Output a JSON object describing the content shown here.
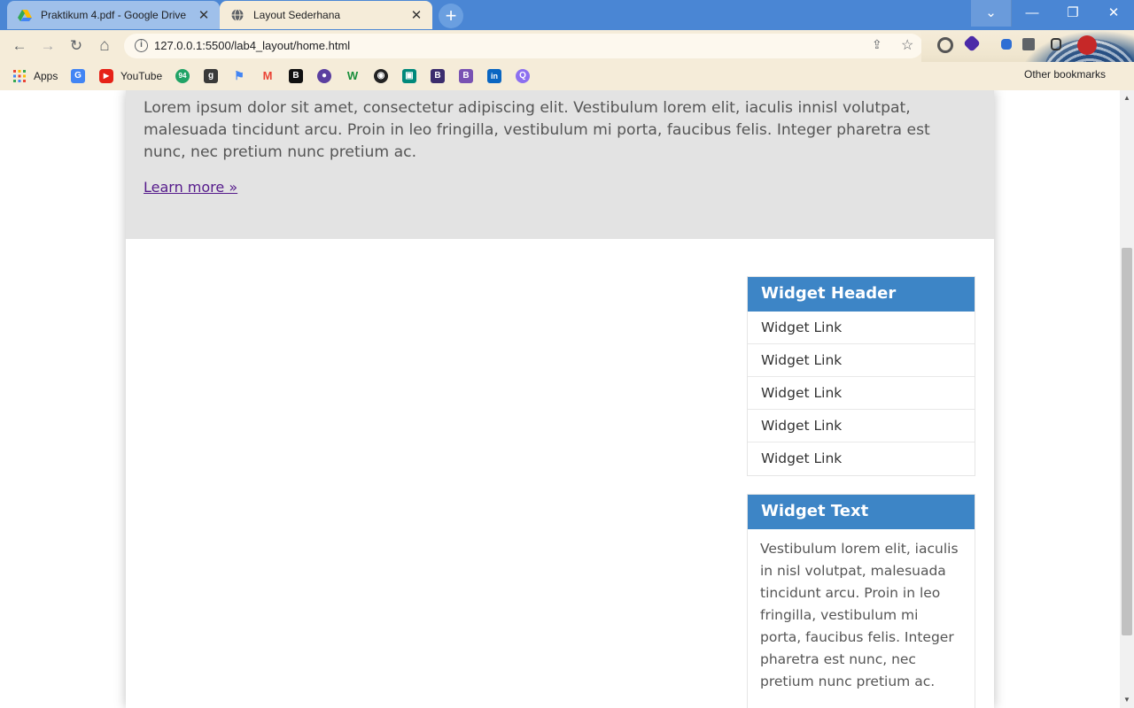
{
  "browser": {
    "tabs": [
      {
        "title": "Praktikum 4.pdf - Google Drive",
        "active": false,
        "close": "✕"
      },
      {
        "title": "Layout Sederhana",
        "active": true,
        "close": "✕"
      }
    ],
    "new_tab_symbol": "+",
    "window_controls": {
      "dropdown": "⌄",
      "minimize": "—",
      "maximize": "❐",
      "close": "✕"
    },
    "nav": {
      "back": "←",
      "forward": "→",
      "reload": "↻",
      "home": "⌂"
    },
    "address_bar": {
      "url": "127.0.0.1:5500/lab4_layout/home.html",
      "info_icon": "i"
    },
    "bookmarks": [
      {
        "label": "Apps",
        "icon": "apps-grid-icon"
      },
      {
        "label": "",
        "icon": "translate-icon"
      },
      {
        "label": "YouTube",
        "icon": "youtube-icon"
      },
      {
        "label": "",
        "icon": "green-94-icon"
      },
      {
        "label": "",
        "icon": "goodreads-icon"
      },
      {
        "label": "",
        "icon": "flag-icon"
      },
      {
        "label": "",
        "icon": "gmail-icon"
      },
      {
        "label": "",
        "icon": "bookmark-b-icon"
      },
      {
        "label": "",
        "icon": "purple-lock-icon"
      },
      {
        "label": "",
        "icon": "w-icon"
      },
      {
        "label": "",
        "icon": "github-icon"
      },
      {
        "label": "",
        "icon": "meet-icon"
      },
      {
        "label": "",
        "icon": "b-dark-icon"
      },
      {
        "label": "",
        "icon": "bootstrap-icon"
      },
      {
        "label": "",
        "icon": "linkedin-icon"
      },
      {
        "label": "",
        "icon": "q-icon"
      }
    ],
    "other_bookmarks": "Other bookmarks"
  },
  "page": {
    "hero": {
      "text": "Lorem ipsum dolor sit amet, consectetur adipiscing elit. Vestibulum lorem elit, iaculis innisl volutpat, malesuada tincidunt arcu. Proin in leo fringilla, vestibulum mi porta, faucibus felis. Integer pharetra est nunc, nec pretium nunc pretium ac.",
      "link": "Learn more »"
    },
    "widget_links": {
      "header": "Widget Header",
      "links": [
        "Widget Link",
        "Widget Link",
        "Widget Link",
        "Widget Link",
        "Widget Link"
      ]
    },
    "widget_text": {
      "header": "Widget Text",
      "body": "Vestibulum lorem elit, iaculis in nisl volutpat, malesuada tincidunt arcu. Proin in leo fringilla, vestibulum mi porta, faucibus felis. Integer pharetra est nunc, nec pretium nunc pretium ac."
    }
  },
  "colors": {
    "tabbar": "#4a86d4",
    "widget_header": "#3d85c6",
    "hero_background": "#e3e3e3",
    "link": "#551a8b"
  }
}
